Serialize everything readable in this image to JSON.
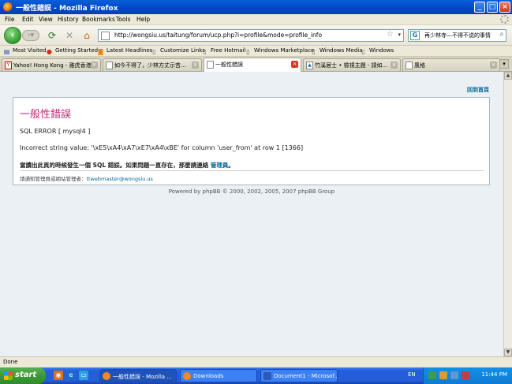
{
  "window": {
    "title": "一般性錯誤 - Mozilla Firefox"
  },
  "menu": [
    "File",
    "Edit",
    "View",
    "History",
    "Bookmarks",
    "Tools",
    "Help"
  ],
  "nav": {
    "url": "http://wongsiu.us/taitung/forum/ucp.php?i=profile&mode=profile_info",
    "search_value": "再少林寺—不得不说的事情"
  },
  "bookmarks": [
    "Most Visited",
    "Getting Started",
    "Latest Headlines",
    "Customize Links",
    "Free Hotmail",
    "Windows Marketplace",
    "Windows Media",
    "Windows"
  ],
  "tabs": [
    {
      "label": "Yahoo! Hong Kong - 雅虎香港",
      "active": false
    },
    {
      "label": "如今不得了，少林方丈示苦...",
      "active": false
    },
    {
      "label": "一般性錯誤",
      "active": true
    },
    {
      "label": "竹溪居士 • 檢視主題 - 請如...",
      "active": false
    },
    {
      "label": "風格",
      "active": false
    }
  ],
  "page": {
    "back_home": "回到首頁",
    "error_title": "一般性錯誤",
    "sql_error": "SQL ERROR [ mysql4 ]",
    "error_detail": "Incorrect string value: '\\xE5\\xA4\\xA7\\xE7\\xA4\\xBE' for column 'user_from' at row 1 [1366]",
    "notice_text": "當讀出此頁的時候發生一個 SQL 錯誤。如果問題一直存在，那麼請連絡 ",
    "notice_link": "管理員",
    "notice_end": "。",
    "contact_text": "請通知管理員或網站管理者：",
    "contact_email": "ttwebmaster@wongsiu.us",
    "powered": "Powered by phpBB © 2000, 2002, 2005, 2007 phpBB Group"
  },
  "status": "Done",
  "taskbar": {
    "start": "start",
    "tasks": [
      {
        "label": "一般性錯誤 - Mozilla ...",
        "active": true
      },
      {
        "label": "Downloads",
        "active": false
      },
      {
        "label": "Document1 - Microsof...",
        "active": false
      }
    ],
    "lang": "EN",
    "clock": "11:44 PM"
  },
  "colors": {
    "title_pink": "#c1267a",
    "link_blue": "#006597",
    "page_bg": "#eaf0f4",
    "xp_blue": "#245edb"
  }
}
